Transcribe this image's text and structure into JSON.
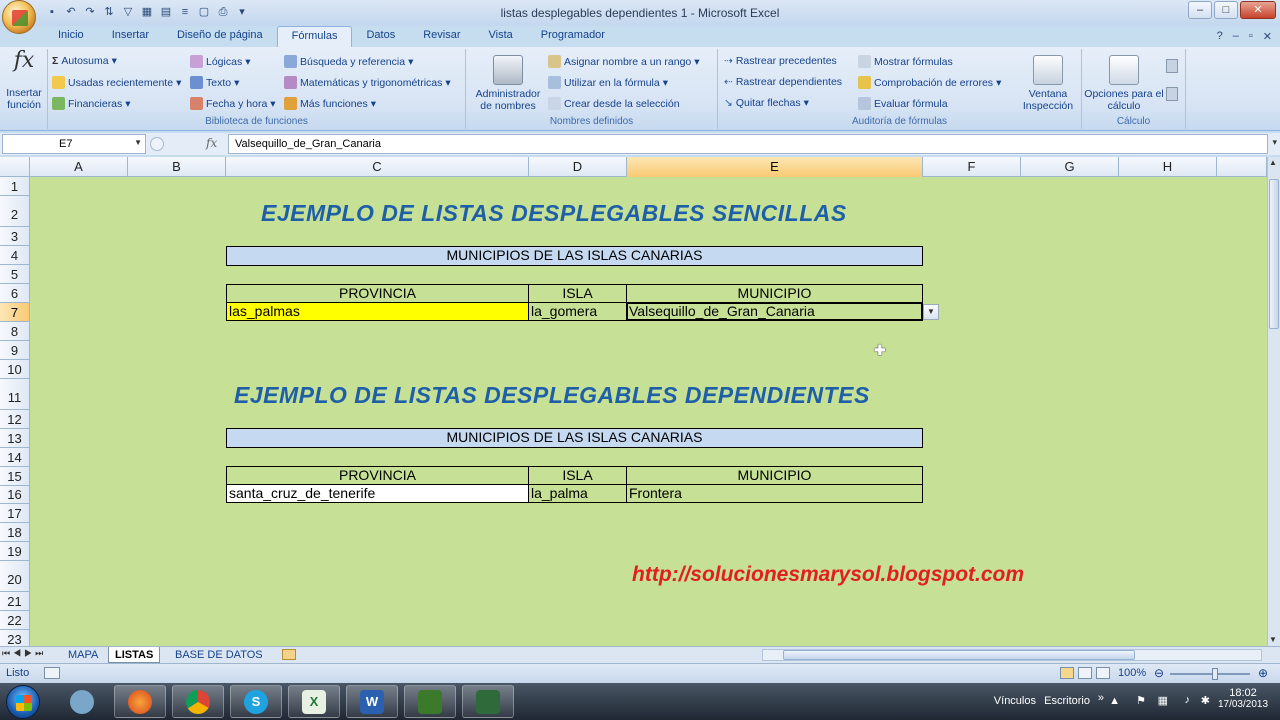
{
  "window": {
    "title": "listas desplegables dependientes 1 - Microsoft Excel"
  },
  "tabs": [
    "Inicio",
    "Insertar",
    "Diseño de página",
    "Fórmulas",
    "Datos",
    "Revisar",
    "Vista",
    "Programador"
  ],
  "active_tab": "Fórmulas",
  "ribbon": {
    "insert_function": "Insertar función",
    "biblioteca": {
      "label": "Biblioteca de funciones",
      "col1": [
        "Autosuma",
        "Usadas recientemente",
        "Financieras"
      ],
      "col2": [
        "Lógicas",
        "Texto",
        "Fecha y hora"
      ],
      "col3": [
        "Búsqueda y referencia",
        "Matemáticas y trigonométricas",
        "Más funciones"
      ]
    },
    "nombres": {
      "label": "Nombres definidos",
      "admin": "Administrador de nombres",
      "items": [
        "Asignar nombre a un rango",
        "Utilizar en la fórmula",
        "Crear desde la selección"
      ]
    },
    "auditoria": {
      "label": "Auditoría de fórmulas",
      "col1": [
        "Rastrear precedentes",
        "Rastrear dependientes",
        "Quitar flechas"
      ],
      "col2": [
        "Mostrar fórmulas",
        "Comprobación de errores",
        "Evaluar fórmula"
      ],
      "ventana": "Ventana Inspección"
    },
    "calculo": {
      "label": "Cálculo",
      "opciones": "Opciones para el cálculo"
    }
  },
  "formula_bar": {
    "name_box": "E7",
    "value": "Valsequillo_de_Gran_Canaria"
  },
  "columns": [
    "A",
    "B",
    "C",
    "D",
    "E",
    "F",
    "G",
    "H"
  ],
  "selected_column": "E",
  "rows": [
    "1",
    "2",
    "3",
    "4",
    "5",
    "6",
    "7",
    "8",
    "9",
    "10",
    "11",
    "12",
    "13",
    "14",
    "15",
    "16",
    "17",
    "18",
    "19",
    "20",
    "21",
    "22",
    "23"
  ],
  "selected_row": "7",
  "sheet": {
    "title1": "EJEMPLO DE LISTAS DESPLEGABLES SENCILLAS",
    "banner1": "MUNICIPIOS DE LAS ISLAS CANARIAS",
    "table1": {
      "headers": [
        "PROVINCIA",
        "ISLA",
        "MUNICIPIO"
      ],
      "values": [
        "las_palmas",
        "la_gomera",
        "Valsequillo_de_Gran_Canaria"
      ]
    },
    "title2": "EJEMPLO DE LISTAS DESPLEGABLES DEPENDIENTES",
    "banner2": "MUNICIPIOS DE LAS ISLAS CANARIAS",
    "table2": {
      "headers": [
        "PROVINCIA",
        "ISLA",
        "MUNICIPIO"
      ],
      "values": [
        "santa_cruz_de_tenerife",
        "la_palma",
        "Frontera"
      ]
    },
    "url": "http://solucionesmarysol.blogspot.com"
  },
  "sheet_tabs": [
    "MAPA",
    "LISTAS",
    "BASE DE DATOS"
  ],
  "active_sheet": "LISTAS",
  "status": {
    "text": "Listo",
    "zoom": "100%"
  },
  "taskbar": {
    "tray_labels": [
      "Vínculos",
      "Escritorio"
    ],
    "time": "18:02",
    "date": "17/03/2013"
  },
  "colors": {
    "sheet_bg": "#c6e196",
    "title_blue": "#1f5fa8",
    "url_red": "#e02020",
    "banner_blue": "#c5d9f1",
    "province_yellow": "#ffff00"
  }
}
